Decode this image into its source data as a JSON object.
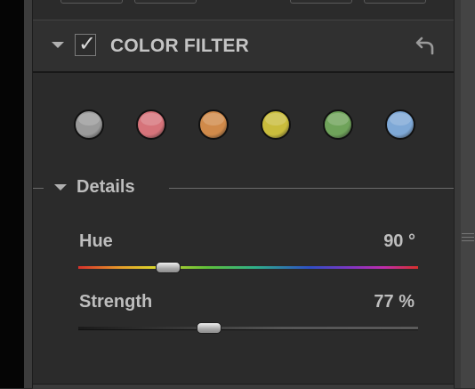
{
  "header": {
    "title": "COLOR FILTER",
    "enabled": true,
    "icons": {
      "expand": "triangle-down-icon",
      "reset": "undo-arrow-icon",
      "check": "check-icon"
    }
  },
  "swatches": [
    {
      "name": "gray",
      "color": "#9a9a9a"
    },
    {
      "name": "red",
      "color": "#d6737a"
    },
    {
      "name": "orange",
      "color": "#d08a4a"
    },
    {
      "name": "yellow",
      "color": "#c9bc3c"
    },
    {
      "name": "green",
      "color": "#6fa35a"
    },
    {
      "name": "blue",
      "color": "#7ea8d6"
    }
  ],
  "details": {
    "label": "Details",
    "sliders": {
      "hue": {
        "label": "Hue",
        "value_text": "90 °",
        "value": 90,
        "position": 0.265
      },
      "strength": {
        "label": "Strength",
        "value_text": "77 %",
        "value": 77,
        "position": 0.385
      }
    }
  }
}
